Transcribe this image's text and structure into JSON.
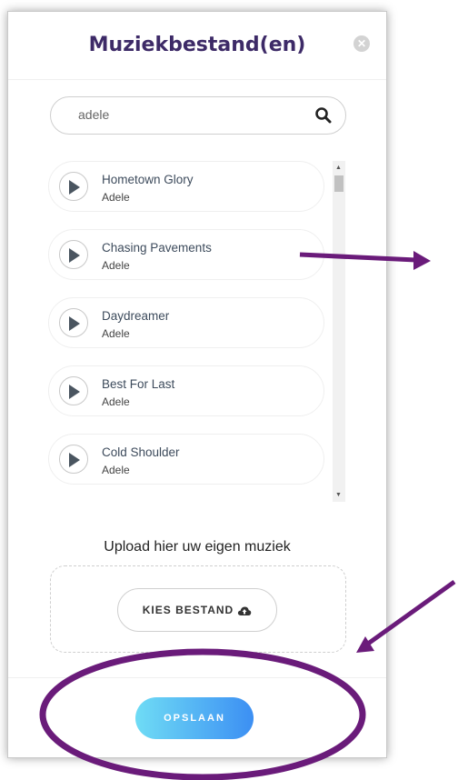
{
  "dialog": {
    "title": "Muziekbestand(en)",
    "close_symbol": "✕"
  },
  "search": {
    "value": "adele",
    "icon": "search-icon"
  },
  "songs": [
    {
      "title": "Hometown Glory",
      "artist": "Adele"
    },
    {
      "title": "Chasing Pavements",
      "artist": "Adele"
    },
    {
      "title": "Daydreamer",
      "artist": "Adele"
    },
    {
      "title": "Best For Last",
      "artist": "Adele"
    },
    {
      "title": "Cold Shoulder",
      "artist": "Adele"
    }
  ],
  "upload": {
    "label": "Upload hier uw eigen muziek",
    "button_label": "KIES BESTAND",
    "button_icon": "cloud-upload-icon"
  },
  "footer": {
    "save_label": "OPSLAAN"
  },
  "colors": {
    "title": "#3d2a67",
    "annotation": "#6a1b7a",
    "save_gradient_start": "#6fdcf5",
    "save_gradient_end": "#3c8ff3"
  }
}
